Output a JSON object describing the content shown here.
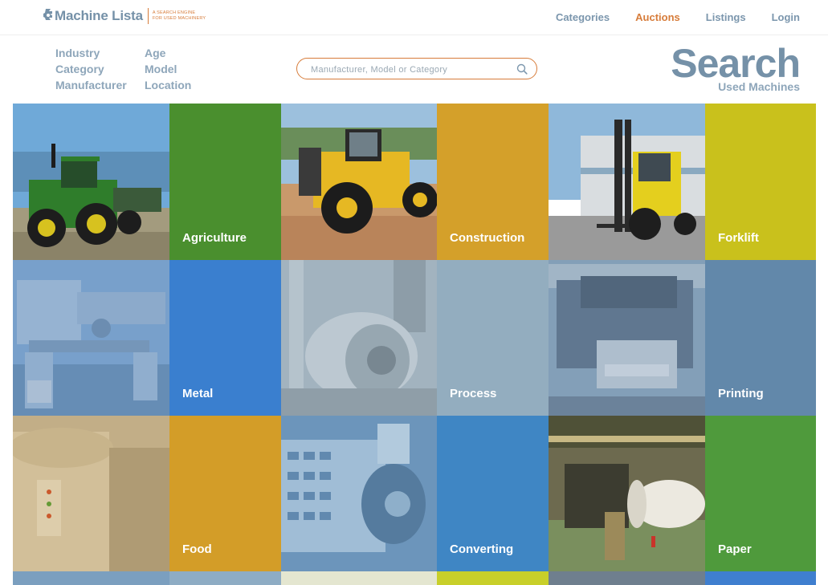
{
  "brand": {
    "name": "Machine Lista",
    "tagline_line1": "A SEARCH ENGINE",
    "tagline_line2": "FOR USED MACHINERY"
  },
  "topnav": [
    {
      "label": "Categories",
      "active": false
    },
    {
      "label": "Auctions",
      "active": true
    },
    {
      "label": "Listings",
      "active": false
    },
    {
      "label": "Login",
      "active": false
    }
  ],
  "filters": [
    "Industry",
    "Age",
    "Category",
    "Model",
    "Manufacturer",
    "Location"
  ],
  "search": {
    "placeholder": "Manufacturer, Model or Category",
    "title": "Search",
    "subtitle": "Used Machines"
  },
  "colors": {
    "accent": "#d77c3a",
    "brand": "#7591a8"
  },
  "categories": [
    {
      "label": "Agriculture",
      "color": "#4a8f2e",
      "photo": "tractor"
    },
    {
      "label": "Construction",
      "color": "#d4a02a",
      "photo": "wheel-loader"
    },
    {
      "label": "Forklift",
      "color": "#c9c11c",
      "photo": "forklift"
    },
    {
      "label": "Metal",
      "color": "#3a7fcf",
      "photo": "lathe"
    },
    {
      "label": "Process",
      "color": "#93adbf",
      "photo": "process-machine"
    },
    {
      "label": "Printing",
      "color": "#6288aa",
      "photo": "printing-press"
    },
    {
      "label": "Food",
      "color": "#d39d28",
      "photo": "food-machine"
    },
    {
      "label": "Converting",
      "color": "#3f86c4",
      "photo": "converting-machine"
    },
    {
      "label": "Paper",
      "color": "#4f9a3c",
      "photo": "paper-mill"
    }
  ]
}
